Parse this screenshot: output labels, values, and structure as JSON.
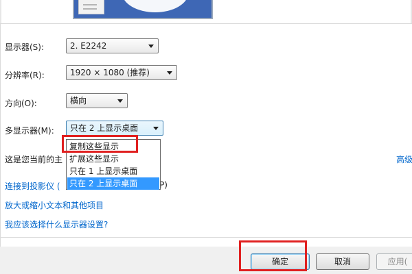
{
  "display": {
    "label": "显示器(S):",
    "value": "2. E2242"
  },
  "resolution": {
    "label": "分辨率(R):",
    "value": "1920 × 1080 (推荐)"
  },
  "orientation": {
    "label": "方向(O):",
    "value": "横向"
  },
  "multiple_displays": {
    "label": "多显示器(M):",
    "value": "只在 2 上显示桌面",
    "options": [
      "复制这些显示",
      "扩展这些显示",
      "只在 1 上显示桌面",
      "只在 2 上显示桌面"
    ],
    "selected_index": 3
  },
  "main_display_text": "这是您当前的主",
  "advanced_link": "高级",
  "links": {
    "projector": "连接到投影仪 (",
    "projector_tail": "P)",
    "text_size": "放大或缩小文本和其他项目",
    "which_settings": "我应该选择什么显示器设置?"
  },
  "buttons": {
    "ok": "确定",
    "cancel": "取消",
    "apply": "应用("
  },
  "colors": {
    "link": "#0066cc",
    "highlight_box": "#e02020",
    "selection": "#3399ff"
  }
}
